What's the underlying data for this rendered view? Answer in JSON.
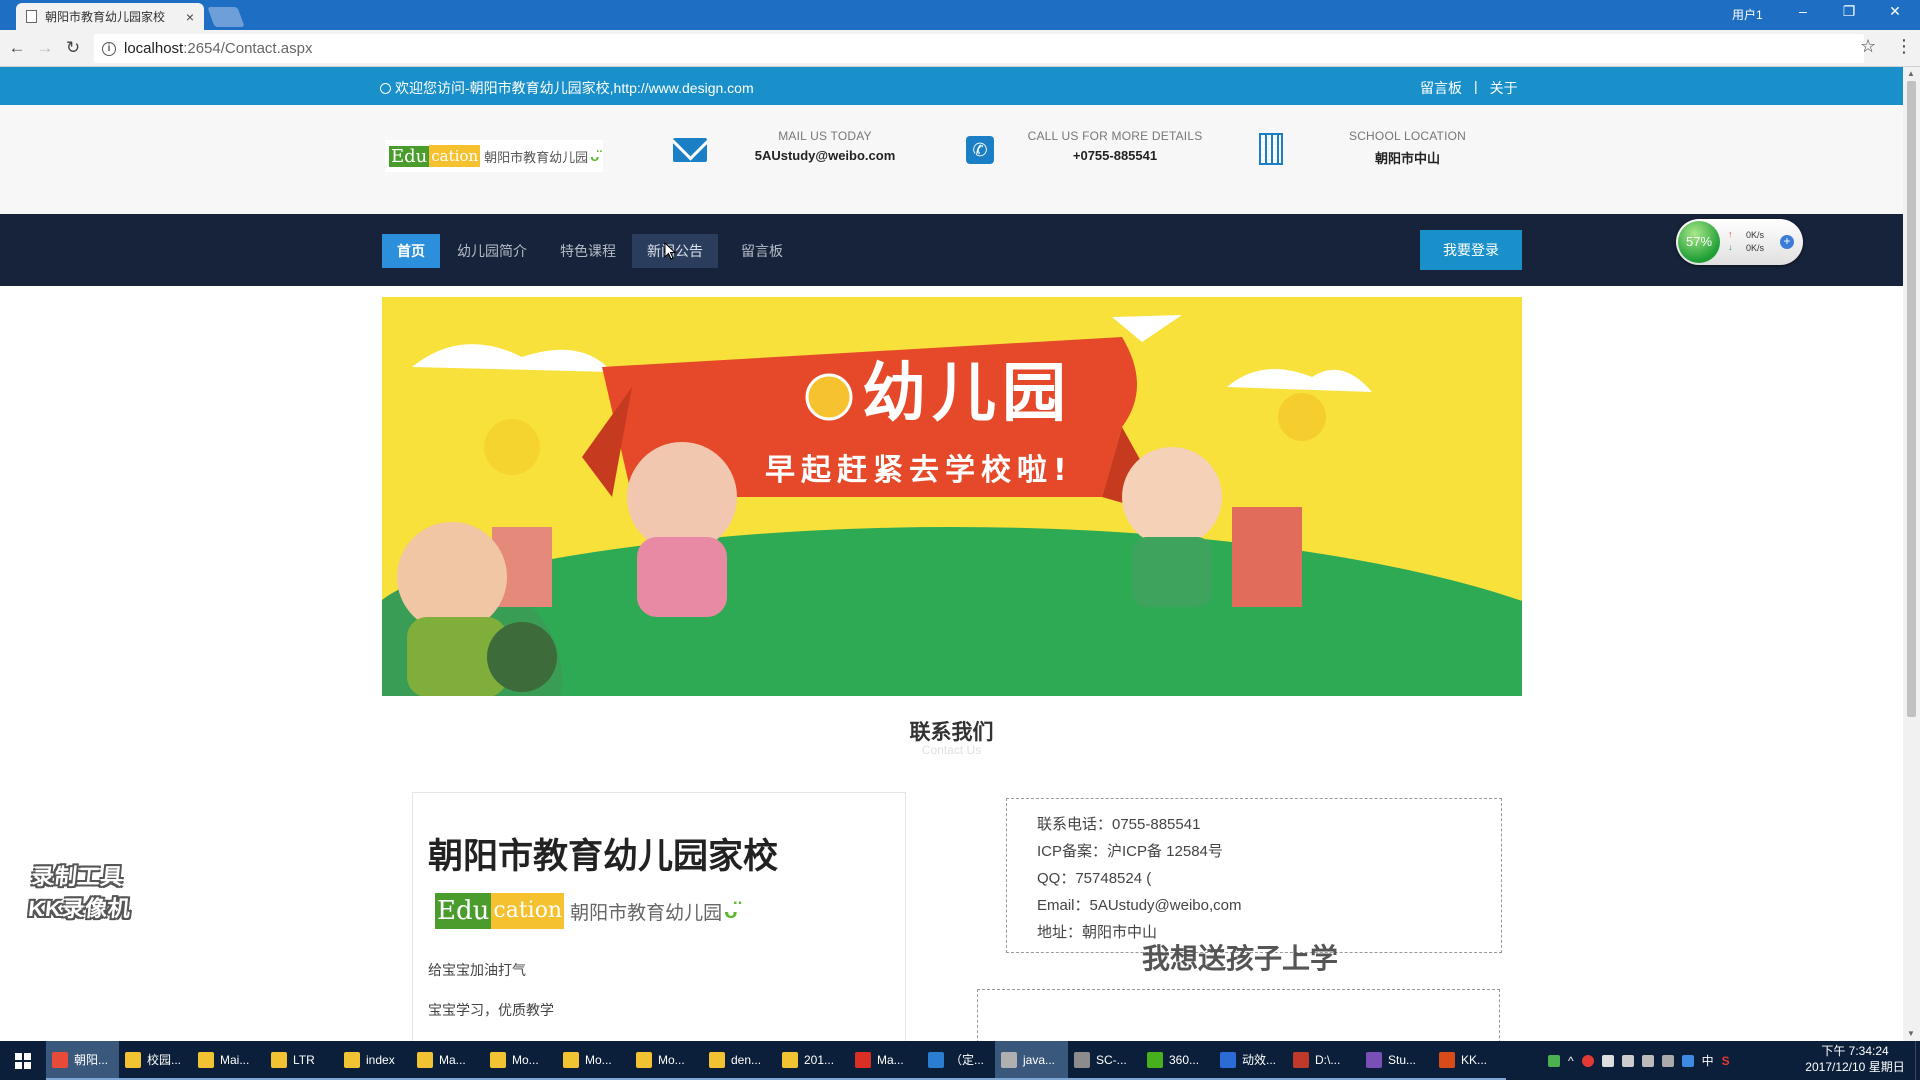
{
  "browser": {
    "tab_title": "朝阳市教育幼儿园家校",
    "tab_close": "×",
    "window_user": "用户1",
    "win_min": "–",
    "win_restore": "❐",
    "win_close": "✕",
    "back": "←",
    "forward": "→",
    "reload": "↻",
    "info": "i",
    "url_host": "localhost",
    "url_path": ":2654/Contact.aspx",
    "star": "☆",
    "menu": "⋮"
  },
  "topbar": {
    "welcome": "欢迎您访问-朝阳市教育幼儿园家校,http://www.design.com",
    "links": [
      "留言板",
      "|",
      "关于"
    ]
  },
  "header": {
    "logo": {
      "edu_green": "Edu",
      "edu_yellow": "cation",
      "name": "朝阳市教育幼儿园",
      "smile": "ᴗ̈"
    },
    "mail": {
      "label": "MAIL US TODAY",
      "value": "5AUstudy@weibo.com"
    },
    "call": {
      "label": "CALL US FOR MORE DETAILS",
      "value": "+0755-885541",
      "icon": "✆"
    },
    "location": {
      "label": "SCHOOL LOCATION",
      "value": "朝阳市中山"
    }
  },
  "nav": {
    "items": [
      "首页",
      "幼儿园简介",
      "特色课程",
      "新闻公告",
      "留言板"
    ],
    "active_index": 0,
    "hover_index": 3,
    "login": "我要登录"
  },
  "speed_widget": {
    "percent": "57%",
    "up": "0K/s",
    "down": "0K/s",
    "up_arrow": "↑",
    "down_arrow": "↓",
    "plus": "+"
  },
  "banner": {
    "title": "幼儿园",
    "subtitle": "早起赶紧去学校啦!",
    "slide_count": 2,
    "active_slide": 0
  },
  "section": {
    "title": "联系我们",
    "subtitle": "Contact Us"
  },
  "left_card": {
    "school_name": "朝阳市教育幼儿园家校",
    "logo": {
      "edu_green": "Edu",
      "edu_yellow": "cation",
      "name": "朝阳市教育幼儿园",
      "smile": "ᴗ̈"
    },
    "lines": [
      "给宝宝加油打气",
      "宝宝学习，优质教学"
    ]
  },
  "info_box": {
    "lines": [
      "联系电话：0755-885541",
      "ICP备案：沪ICP备 12584号",
      "QQ：75748524 (",
      "Email：5AUstudy@weibo,com",
      "地址：朝阳市中山"
    ]
  },
  "right_title": "我想送孩子上学",
  "watermark": {
    "line1": "录制工具",
    "line2": "KK录像机"
  },
  "taskbar": {
    "items": [
      {
        "label": "朝阳...",
        "color": "#e84a3a",
        "active": true
      },
      {
        "label": "校园...",
        "color": "#f1c232",
        "active": false
      },
      {
        "label": "Mai...",
        "color": "#f1c232",
        "active": false
      },
      {
        "label": "LTR",
        "color": "#f1c232",
        "active": false
      },
      {
        "label": "index",
        "color": "#f1c232",
        "active": false
      },
      {
        "label": "Ma...",
        "color": "#f1c232",
        "active": false
      },
      {
        "label": "Mo...",
        "color": "#f1c232",
        "active": false
      },
      {
        "label": "Mo...",
        "color": "#f1c232",
        "active": false
      },
      {
        "label": "Mo...",
        "color": "#f1c232",
        "active": false
      },
      {
        "label": "den...",
        "color": "#f1c232",
        "active": false
      },
      {
        "label": "201...",
        "color": "#f1c232",
        "active": false
      },
      {
        "label": "Ma...",
        "color": "#d93025",
        "active": false
      },
      {
        "label": "（定...",
        "color": "#2b7cd3",
        "active": false
      },
      {
        "label": "java...",
        "color": "#b0b0b0",
        "active": true
      },
      {
        "label": "SC-...",
        "color": "#8c8c8c",
        "active": false
      },
      {
        "label": "360...",
        "color": "#46b01f",
        "active": false
      },
      {
        "label": "动效...",
        "color": "#2c6cd6",
        "active": false
      },
      {
        "label": "D:\\...",
        "color": "#c0392b",
        "active": false
      },
      {
        "label": "Stu...",
        "color": "#7b4fb8",
        "active": false
      },
      {
        "label": "KK...",
        "color": "#d94c1a",
        "active": false
      }
    ],
    "tray": [
      "^",
      "中",
      "S"
    ],
    "time": "下午 7:34:24",
    "date": "2017/12/10 星期日"
  }
}
